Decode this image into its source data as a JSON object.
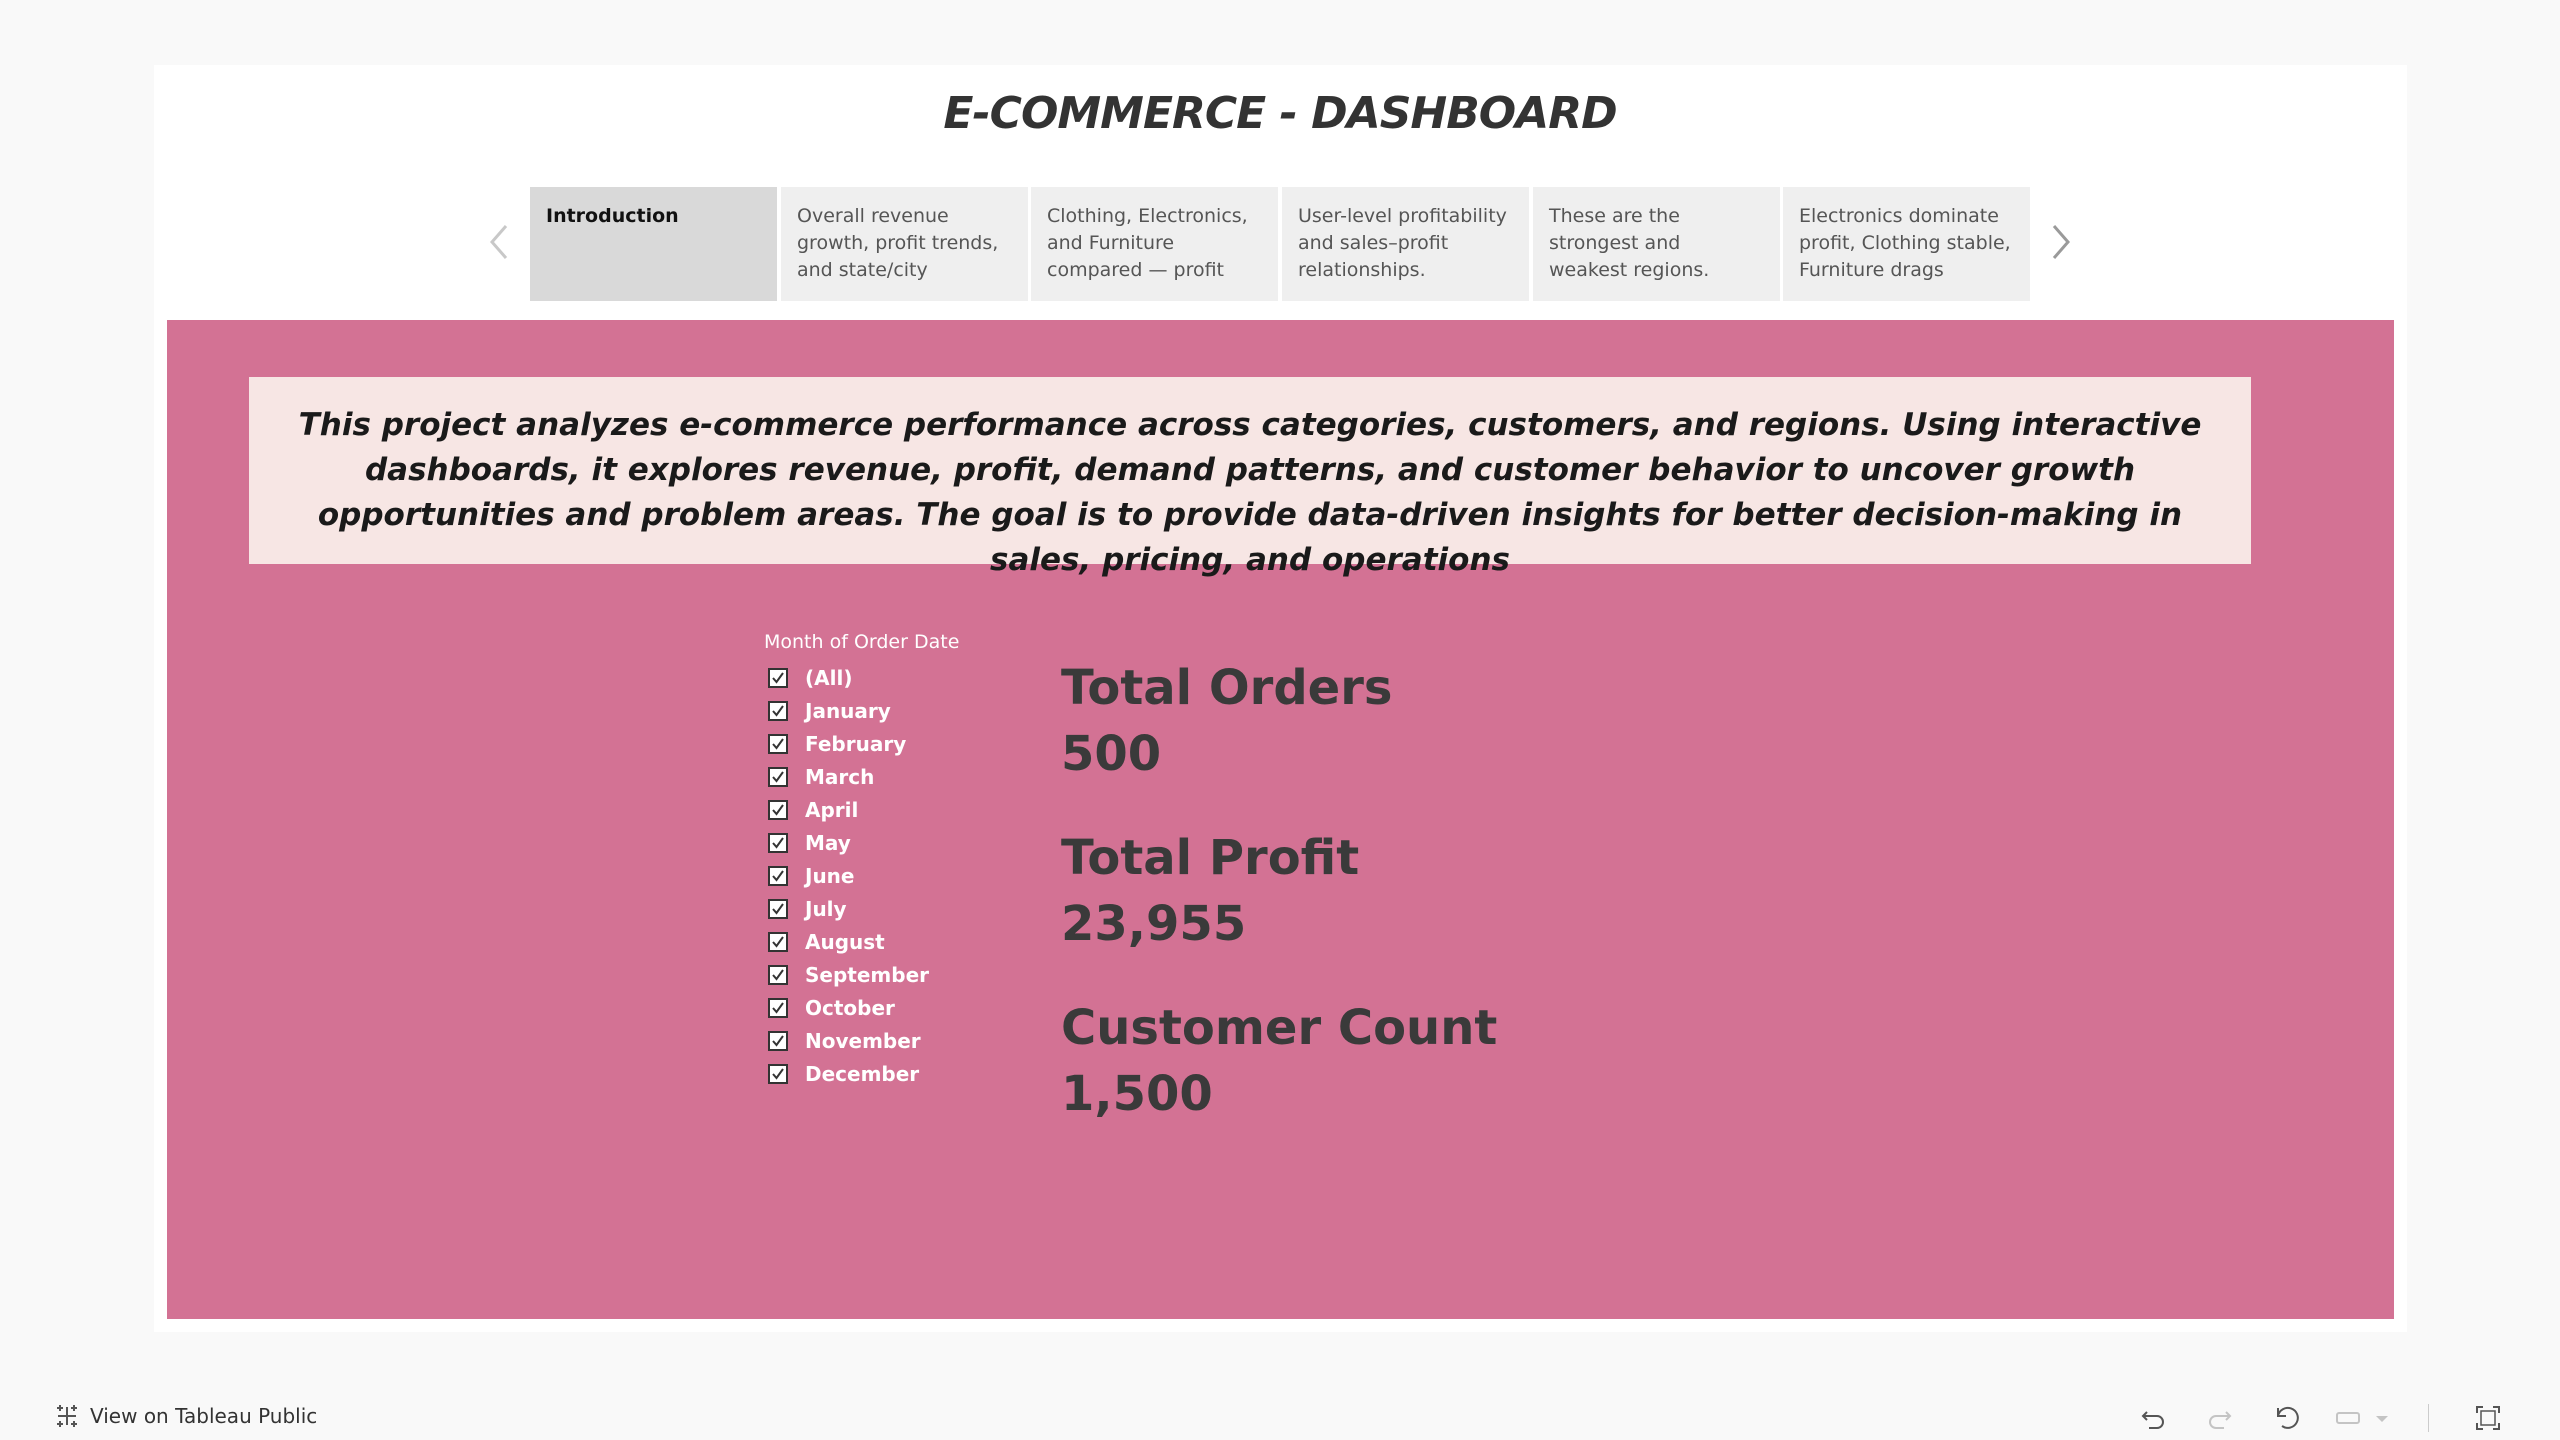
{
  "dashboard": {
    "title": "E-COMMERCE - DASHBOARD"
  },
  "story": {
    "points": [
      {
        "label": "Introduction",
        "active": true
      },
      {
        "label": "Overall revenue growth, profit trends, and state/city",
        "active": false
      },
      {
        "label": "Clothing, Electronics, and Furniture compared — profit",
        "active": false
      },
      {
        "label": "User-level profitability and sales–profit relationships.",
        "active": false
      },
      {
        "label": "These are the strongest and weakest regions.",
        "active": false
      },
      {
        "label": "Electronics dominate profit, Clothing stable, Furniture drags",
        "active": false
      }
    ],
    "prev_icon": "chevron-left-icon",
    "next_icon": "chevron-right-icon"
  },
  "intro": {
    "text": "This project analyzes e-commerce performance across categories, customers, and regions. Using interactive dashboards, it explores revenue, profit, demand patterns, and customer behavior to uncover growth opportunities and problem areas. The goal is to provide data-driven insights for better decision-making in sales, pricing, and operations"
  },
  "filter": {
    "title": "Month of Order Date",
    "options": [
      {
        "label": "(All)",
        "checked": true
      },
      {
        "label": "January",
        "checked": true
      },
      {
        "label": "February",
        "checked": true
      },
      {
        "label": "March",
        "checked": true
      },
      {
        "label": "April",
        "checked": true
      },
      {
        "label": "May",
        "checked": true
      },
      {
        "label": "June",
        "checked": true
      },
      {
        "label": "July",
        "checked": true
      },
      {
        "label": "August",
        "checked": true
      },
      {
        "label": "September",
        "checked": true
      },
      {
        "label": "October",
        "checked": true
      },
      {
        "label": "November",
        "checked": true
      },
      {
        "label": "December",
        "checked": true
      }
    ]
  },
  "kpis": {
    "total_orders": {
      "label": "Total Orders",
      "value": "500"
    },
    "total_profit": {
      "label": "Total Profit",
      "value": "23,955"
    },
    "customer_count": {
      "label": "Customer Count",
      "value": "1,500"
    }
  },
  "footer": {
    "view_link": "View on Tableau Public",
    "icons": [
      "undo-icon",
      "redo-icon",
      "revert-icon",
      "pause-icon",
      "dropdown-icon",
      "fullscreen-icon"
    ]
  },
  "colors": {
    "panel": "#d37294",
    "intro_bg": "#f7e6e4",
    "kpi_text": "#3a3a3a"
  }
}
